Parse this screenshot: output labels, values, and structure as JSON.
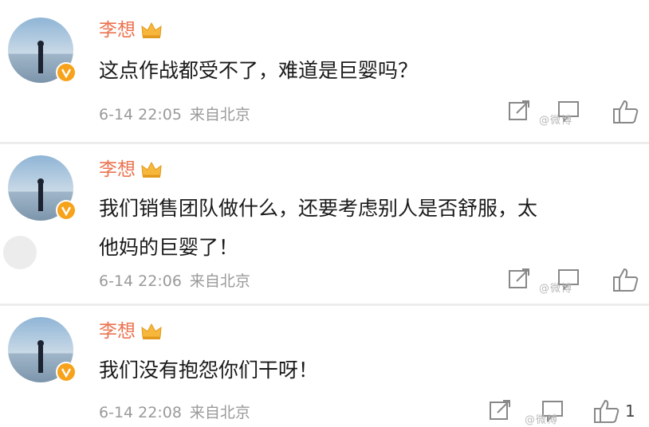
{
  "comments": [
    {
      "username": "李想",
      "text_lines": [
        "这点作战都受不了，难道是巨婴吗？"
      ],
      "date": "6-14 22:05",
      "source": "来自北京",
      "like_count": ""
    },
    {
      "username": "李想",
      "text_lines": [
        "我们销售团队做什么，还要考虑别人是否舒服，太",
        "他妈的巨婴了！"
      ],
      "date": "6-14 22:06",
      "source": "来自北京",
      "like_count": ""
    },
    {
      "username": "李想",
      "text_lines": [
        "我们没有抱怨你们干呀！"
      ],
      "date": "6-14 22:08",
      "source": "来自北京",
      "like_count": "1"
    }
  ],
  "watermark": "@微博",
  "colors": {
    "username": "#eb7350",
    "badge": "#f7a21b",
    "meta": "#9a9a9a",
    "text": "#1a1a1a"
  },
  "icons": [
    "verified-badge-icon",
    "crown-icon",
    "share-icon",
    "comment-icon",
    "like-icon"
  ]
}
